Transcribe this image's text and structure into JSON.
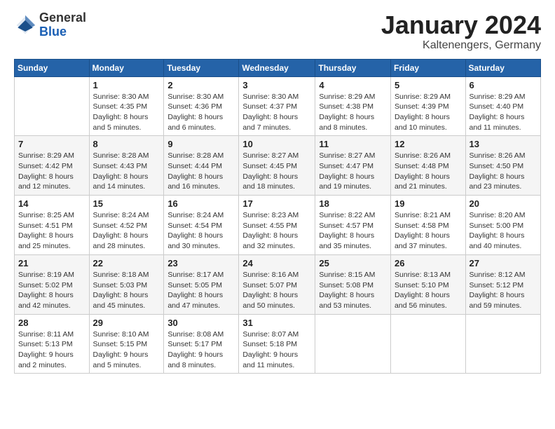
{
  "header": {
    "logo_general": "General",
    "logo_blue": "Blue",
    "month": "January 2024",
    "location": "Kaltenengers, Germany"
  },
  "days_of_week": [
    "Sunday",
    "Monday",
    "Tuesday",
    "Wednesday",
    "Thursday",
    "Friday",
    "Saturday"
  ],
  "weeks": [
    [
      {
        "day": "",
        "sunrise": "",
        "sunset": "",
        "daylight": ""
      },
      {
        "day": "1",
        "sunrise": "Sunrise: 8:30 AM",
        "sunset": "Sunset: 4:35 PM",
        "daylight": "Daylight: 8 hours and 5 minutes."
      },
      {
        "day": "2",
        "sunrise": "Sunrise: 8:30 AM",
        "sunset": "Sunset: 4:36 PM",
        "daylight": "Daylight: 8 hours and 6 minutes."
      },
      {
        "day": "3",
        "sunrise": "Sunrise: 8:30 AM",
        "sunset": "Sunset: 4:37 PM",
        "daylight": "Daylight: 8 hours and 7 minutes."
      },
      {
        "day": "4",
        "sunrise": "Sunrise: 8:29 AM",
        "sunset": "Sunset: 4:38 PM",
        "daylight": "Daylight: 8 hours and 8 minutes."
      },
      {
        "day": "5",
        "sunrise": "Sunrise: 8:29 AM",
        "sunset": "Sunset: 4:39 PM",
        "daylight": "Daylight: 8 hours and 10 minutes."
      },
      {
        "day": "6",
        "sunrise": "Sunrise: 8:29 AM",
        "sunset": "Sunset: 4:40 PM",
        "daylight": "Daylight: 8 hours and 11 minutes."
      }
    ],
    [
      {
        "day": "7",
        "sunrise": "Sunrise: 8:29 AM",
        "sunset": "Sunset: 4:42 PM",
        "daylight": "Daylight: 8 hours and 12 minutes."
      },
      {
        "day": "8",
        "sunrise": "Sunrise: 8:28 AM",
        "sunset": "Sunset: 4:43 PM",
        "daylight": "Daylight: 8 hours and 14 minutes."
      },
      {
        "day": "9",
        "sunrise": "Sunrise: 8:28 AM",
        "sunset": "Sunset: 4:44 PM",
        "daylight": "Daylight: 8 hours and 16 minutes."
      },
      {
        "day": "10",
        "sunrise": "Sunrise: 8:27 AM",
        "sunset": "Sunset: 4:45 PM",
        "daylight": "Daylight: 8 hours and 18 minutes."
      },
      {
        "day": "11",
        "sunrise": "Sunrise: 8:27 AM",
        "sunset": "Sunset: 4:47 PM",
        "daylight": "Daylight: 8 hours and 19 minutes."
      },
      {
        "day": "12",
        "sunrise": "Sunrise: 8:26 AM",
        "sunset": "Sunset: 4:48 PM",
        "daylight": "Daylight: 8 hours and 21 minutes."
      },
      {
        "day": "13",
        "sunrise": "Sunrise: 8:26 AM",
        "sunset": "Sunset: 4:50 PM",
        "daylight": "Daylight: 8 hours and 23 minutes."
      }
    ],
    [
      {
        "day": "14",
        "sunrise": "Sunrise: 8:25 AM",
        "sunset": "Sunset: 4:51 PM",
        "daylight": "Daylight: 8 hours and 25 minutes."
      },
      {
        "day": "15",
        "sunrise": "Sunrise: 8:24 AM",
        "sunset": "Sunset: 4:52 PM",
        "daylight": "Daylight: 8 hours and 28 minutes."
      },
      {
        "day": "16",
        "sunrise": "Sunrise: 8:24 AM",
        "sunset": "Sunset: 4:54 PM",
        "daylight": "Daylight: 8 hours and 30 minutes."
      },
      {
        "day": "17",
        "sunrise": "Sunrise: 8:23 AM",
        "sunset": "Sunset: 4:55 PM",
        "daylight": "Daylight: 8 hours and 32 minutes."
      },
      {
        "day": "18",
        "sunrise": "Sunrise: 8:22 AM",
        "sunset": "Sunset: 4:57 PM",
        "daylight": "Daylight: 8 hours and 35 minutes."
      },
      {
        "day": "19",
        "sunrise": "Sunrise: 8:21 AM",
        "sunset": "Sunset: 4:58 PM",
        "daylight": "Daylight: 8 hours and 37 minutes."
      },
      {
        "day": "20",
        "sunrise": "Sunrise: 8:20 AM",
        "sunset": "Sunset: 5:00 PM",
        "daylight": "Daylight: 8 hours and 40 minutes."
      }
    ],
    [
      {
        "day": "21",
        "sunrise": "Sunrise: 8:19 AM",
        "sunset": "Sunset: 5:02 PM",
        "daylight": "Daylight: 8 hours and 42 minutes."
      },
      {
        "day": "22",
        "sunrise": "Sunrise: 8:18 AM",
        "sunset": "Sunset: 5:03 PM",
        "daylight": "Daylight: 8 hours and 45 minutes."
      },
      {
        "day": "23",
        "sunrise": "Sunrise: 8:17 AM",
        "sunset": "Sunset: 5:05 PM",
        "daylight": "Daylight: 8 hours and 47 minutes."
      },
      {
        "day": "24",
        "sunrise": "Sunrise: 8:16 AM",
        "sunset": "Sunset: 5:07 PM",
        "daylight": "Daylight: 8 hours and 50 minutes."
      },
      {
        "day": "25",
        "sunrise": "Sunrise: 8:15 AM",
        "sunset": "Sunset: 5:08 PM",
        "daylight": "Daylight: 8 hours and 53 minutes."
      },
      {
        "day": "26",
        "sunrise": "Sunrise: 8:13 AM",
        "sunset": "Sunset: 5:10 PM",
        "daylight": "Daylight: 8 hours and 56 minutes."
      },
      {
        "day": "27",
        "sunrise": "Sunrise: 8:12 AM",
        "sunset": "Sunset: 5:12 PM",
        "daylight": "Daylight: 8 hours and 59 minutes."
      }
    ],
    [
      {
        "day": "28",
        "sunrise": "Sunrise: 8:11 AM",
        "sunset": "Sunset: 5:13 PM",
        "daylight": "Daylight: 9 hours and 2 minutes."
      },
      {
        "day": "29",
        "sunrise": "Sunrise: 8:10 AM",
        "sunset": "Sunset: 5:15 PM",
        "daylight": "Daylight: 9 hours and 5 minutes."
      },
      {
        "day": "30",
        "sunrise": "Sunrise: 8:08 AM",
        "sunset": "Sunset: 5:17 PM",
        "daylight": "Daylight: 9 hours and 8 minutes."
      },
      {
        "day": "31",
        "sunrise": "Sunrise: 8:07 AM",
        "sunset": "Sunset: 5:18 PM",
        "daylight": "Daylight: 9 hours and 11 minutes."
      },
      {
        "day": "",
        "sunrise": "",
        "sunset": "",
        "daylight": ""
      },
      {
        "day": "",
        "sunrise": "",
        "sunset": "",
        "daylight": ""
      },
      {
        "day": "",
        "sunrise": "",
        "sunset": "",
        "daylight": ""
      }
    ]
  ]
}
